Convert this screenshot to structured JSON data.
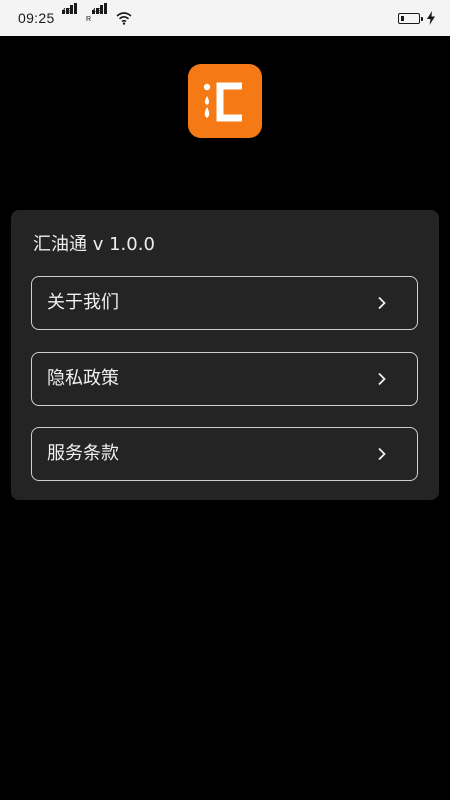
{
  "status_bar": {
    "time": "09:25",
    "sim1_label": "4G",
    "sim2_label": "4G",
    "sim2_roaming": "R"
  },
  "app": {
    "name_version": "汇油通 v 1.0.0",
    "brand_color": "#f57a16"
  },
  "menu": {
    "items": [
      {
        "label": "关于我们"
      },
      {
        "label": "隐私政策"
      },
      {
        "label": "服务条款"
      }
    ]
  }
}
